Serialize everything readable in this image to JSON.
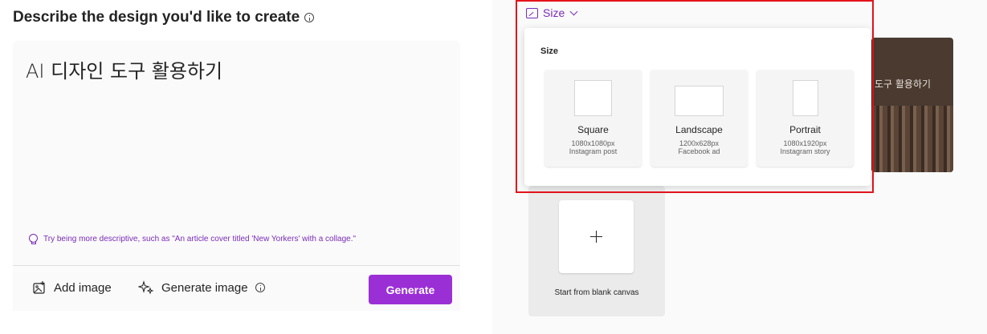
{
  "heading": "Describe the design you'd like to create",
  "prompt": {
    "text": "AI 디자인 도구 활용하기"
  },
  "tip": "Try being more descriptive, such as \"An article cover titled 'New Yorkers' with a collage.\"",
  "toolbar": {
    "add_image": "Add image",
    "generate_image": "Generate image",
    "generate": "Generate"
  },
  "size_menu": {
    "trigger_label": "Size",
    "title": "Size",
    "options": [
      {
        "name": "Square",
        "dimensions": "1080x1080px",
        "use": "Instagram post"
      },
      {
        "name": "Landscape",
        "dimensions": "1200x628px",
        "use": "Facebook ad"
      },
      {
        "name": "Portrait",
        "dimensions": "1080x1920px",
        "use": "Instagram story"
      }
    ]
  },
  "design_card": {
    "text": "도구 활용하기"
  },
  "blank_canvas": {
    "label": "Start from blank canvas"
  },
  "colors": {
    "accent": "#9b2fd6",
    "highlight": "#e4141b"
  }
}
